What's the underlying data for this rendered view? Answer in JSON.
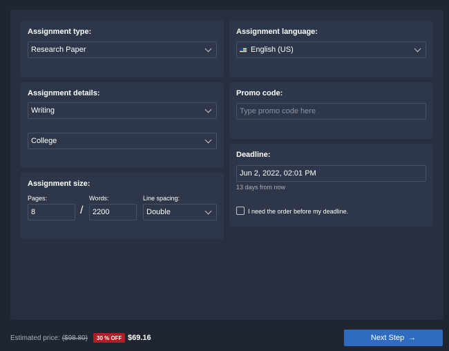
{
  "assignment_type": {
    "title": "Assignment type:",
    "value": "Research Paper"
  },
  "assignment_language": {
    "title": "Assignment language:",
    "value": "English (US)"
  },
  "assignment_details": {
    "title": "Assignment details:",
    "type_value": "Writing",
    "level_value": "College"
  },
  "promo": {
    "title": "Promo code:",
    "placeholder": "Type promo code here"
  },
  "deadline": {
    "title": "Deadline:",
    "value": "Jun 2, 2022, 02:01 PM",
    "sub": "13 days from now",
    "checkbox_label": "I need the order before my deadline."
  },
  "assignment_size": {
    "title": "Assignment size:",
    "pages_label": "Pages:",
    "pages_value": "8",
    "separator": "/",
    "words_label": "Words:",
    "words_value": "2200",
    "spacing_label": "Line spacing:",
    "spacing_value": "Double"
  },
  "footer": {
    "estimated_label": "Estimated price:",
    "old_price": "($98.80)",
    "discount": "30 % OFF",
    "price": "$69.16",
    "next_button": "Next Step",
    "next_arrow": "→"
  },
  "colors": {
    "accent": "#2f6cc0",
    "discount": "#b31b25",
    "background": "#1f2531",
    "panel": "#283040",
    "card": "#2e3749"
  }
}
